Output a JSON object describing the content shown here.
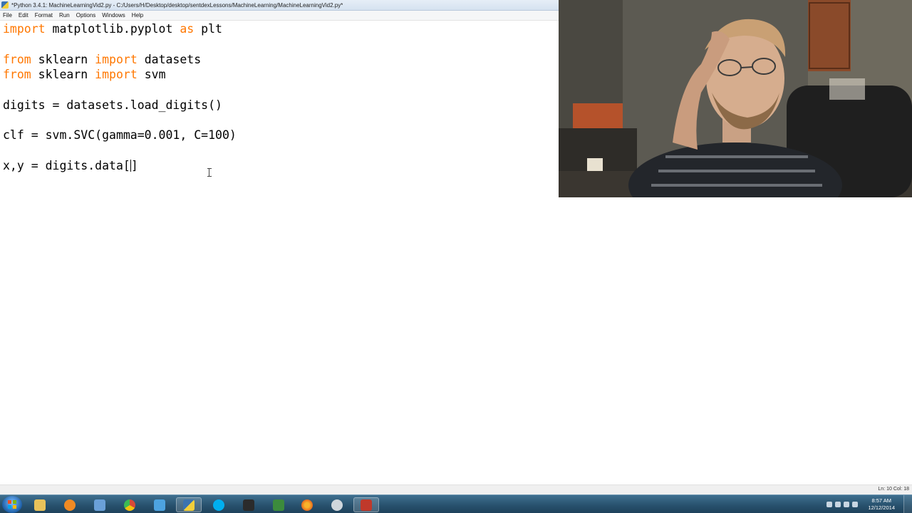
{
  "window": {
    "title": "*Python 3.4.1: MachineLearningVid2.py - C:/Users/H/Desktop/desktop/sentdexLessons/MachineLearning/MachineLearningVid2.py*"
  },
  "menu": {
    "items": [
      "File",
      "Edit",
      "Format",
      "Run",
      "Options",
      "Windows",
      "Help"
    ]
  },
  "editor": {
    "lines": [
      {
        "kw1": "import",
        "rest1": " matplotlib.pyplot ",
        "kw2": "as",
        "rest2": " plt"
      },
      {
        "kw1": "from",
        "rest1": " sklearn ",
        "kw2": "import",
        "rest2": " datasets"
      },
      {
        "kw1": "from",
        "rest1": " sklearn ",
        "kw2": "import",
        "rest2": " svm"
      },
      {
        "text": "digits = datasets.load_digits()"
      },
      {
        "text": "clf = svm.SVC(gamma=0.001, C=100)"
      },
      {
        "before_caret": "x,y = digits.data[",
        "after_caret": "]"
      }
    ]
  },
  "status": {
    "position": "Ln: 10  Col: 18"
  },
  "taskbar": {
    "apps": [
      {
        "icon": "folder-icon",
        "color": "#e8c25a"
      },
      {
        "icon": "media-player-icon",
        "color": "#f08a24"
      },
      {
        "icon": "document-icon",
        "color": "#6aa0d8"
      },
      {
        "icon": "chrome-icon",
        "color": "#d84a38"
      },
      {
        "icon": "paint-icon",
        "color": "#4da3e0"
      },
      {
        "icon": "python-icon",
        "color": "#f2cf3a"
      },
      {
        "icon": "skype-icon",
        "color": "#00aff0"
      },
      {
        "icon": "app-v-icon",
        "color": "#2b2b2b"
      },
      {
        "icon": "terminal-icon",
        "color": "#3c8b3c"
      },
      {
        "icon": "firefox-icon",
        "color": "#e66a1f"
      },
      {
        "icon": "search-app-icon",
        "color": "#cfd6dc"
      },
      {
        "icon": "app-red-icon",
        "color": "#c0392b"
      }
    ],
    "clock": {
      "time": "8:57 AM",
      "date": "12/12/2014"
    }
  }
}
